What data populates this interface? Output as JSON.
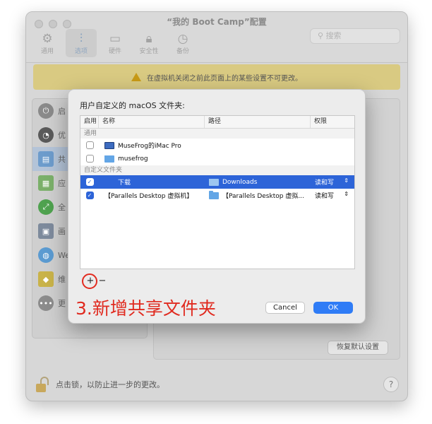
{
  "window": {
    "title": "“我的 Boot Camp”配置"
  },
  "toolbar": {
    "items": [
      {
        "label": "通用",
        "icon": "gear-icon"
      },
      {
        "label": "选项",
        "icon": "sliders-icon"
      },
      {
        "label": "硬件",
        "icon": "chip-icon"
      },
      {
        "label": "安全性",
        "icon": "lock-icon"
      },
      {
        "label": "备份",
        "icon": "clock-icon"
      }
    ],
    "search_placeholder": "搜索"
  },
  "warning": {
    "text": "在虚拟机关闭之前此页面上的某些设置不可更改。"
  },
  "sidebar": {
    "items": [
      {
        "label": "启"
      },
      {
        "label": "优"
      },
      {
        "label": "共"
      },
      {
        "label": "应"
      },
      {
        "label": "全"
      },
      {
        "label": "画"
      },
      {
        "label": "We"
      },
      {
        "label": "维"
      },
      {
        "label": "更"
      }
    ]
  },
  "main": {
    "restore_button": "恢复默认设置"
  },
  "footer": {
    "lock_text": "点击锁，以防止进一步的更改。",
    "help": "?"
  },
  "sheet": {
    "title": "用户自定义的 macOS 文件夹:",
    "columns": {
      "enabled": "启用",
      "name": "名称",
      "path": "路径",
      "permission": "权限"
    },
    "group_general": "通用",
    "group_custom": "自定义文件夹",
    "general_rows": [
      {
        "name": "MuseFrog的iMac Pro",
        "checked": false
      },
      {
        "name": "musefrog",
        "checked": false
      }
    ],
    "custom_rows": [
      {
        "name": "下载",
        "path": "Downloads",
        "permission": "读和写",
        "checked": true,
        "selected": true
      },
      {
        "name": "【Parallels Desktop 虚拟机】",
        "path": "【Parallels Desktop 虚拟...",
        "permission": "读和写",
        "checked": true,
        "selected": false
      }
    ],
    "add_button": "+",
    "remove_button": "−",
    "annotation": "3.新增共享文件夹",
    "cancel_button": "Cancel",
    "ok_button": "OK"
  },
  "colors": {
    "accent": "#2d64d8",
    "ok_button": "#2f7cf6",
    "annotation": "#e02a1f",
    "warning_bar": "#d9ca82"
  }
}
